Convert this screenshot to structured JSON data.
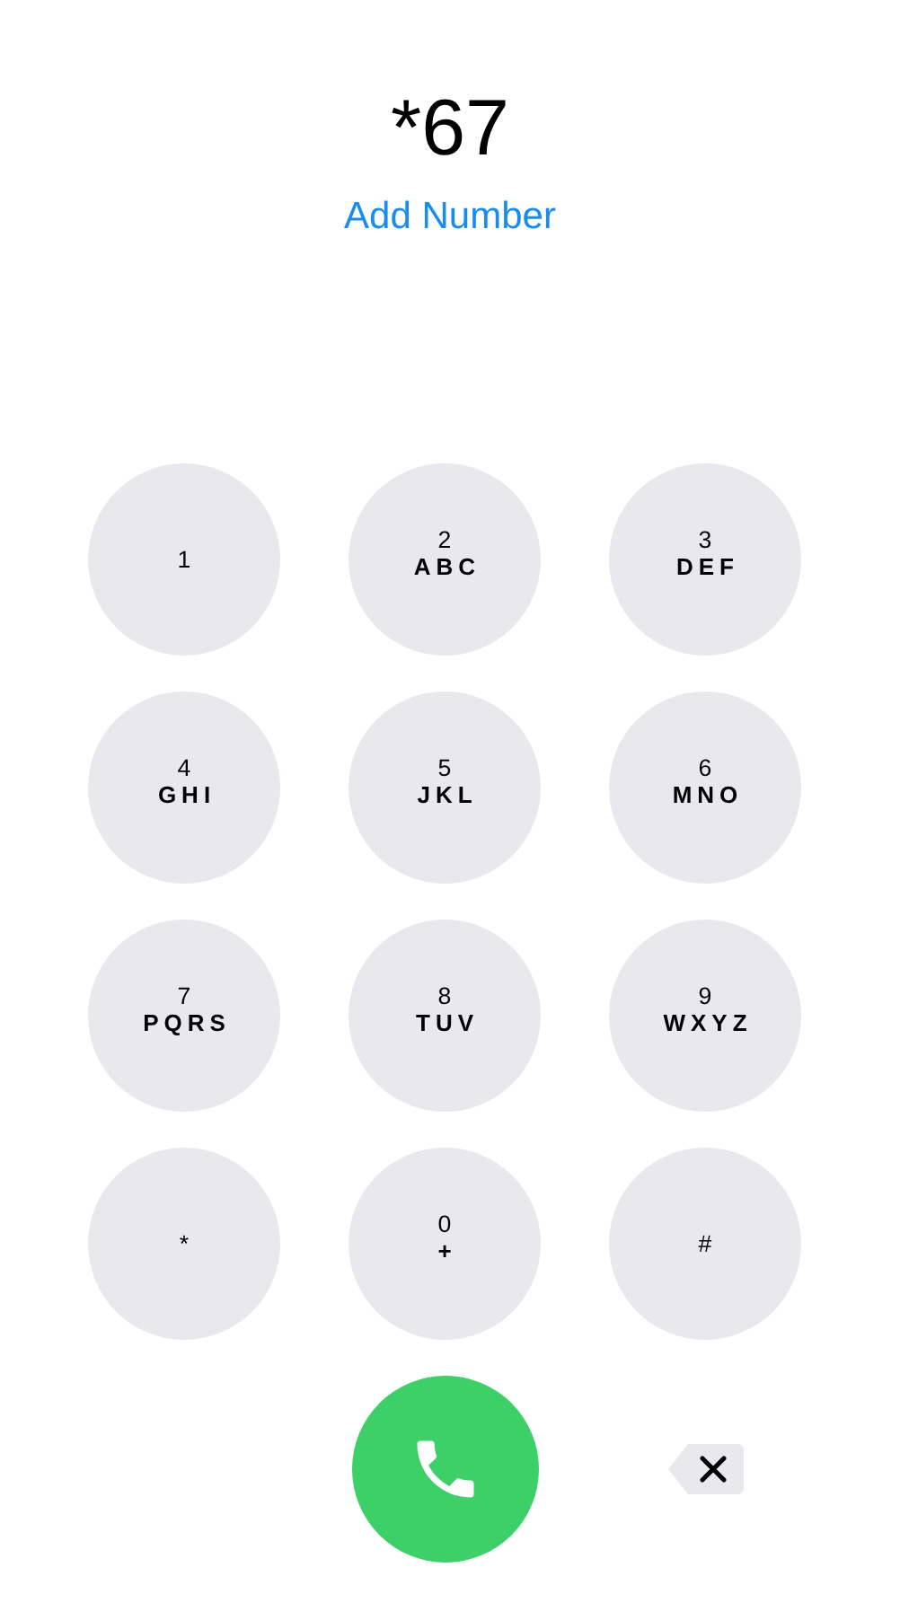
{
  "display": {
    "number": "*67",
    "add_number_link": "Add Number"
  },
  "keys": [
    {
      "digit": "1"
    },
    {
      "digit": "2",
      "letters": "ABC"
    },
    {
      "digit": "3",
      "letters": "DEF"
    },
    {
      "digit": "4",
      "letters": "GHI"
    },
    {
      "digit": "5",
      "letters": "JKL"
    },
    {
      "digit": "6",
      "letters": "MNO"
    },
    {
      "digit": "7",
      "letters": "PQRS"
    },
    {
      "digit": "8",
      "letters": "TUV"
    },
    {
      "digit": "9",
      "letters": "WXYZ"
    },
    {
      "digit": "*"
    },
    {
      "digit": "0",
      "letters": "+"
    },
    {
      "digit": "#"
    }
  ]
}
